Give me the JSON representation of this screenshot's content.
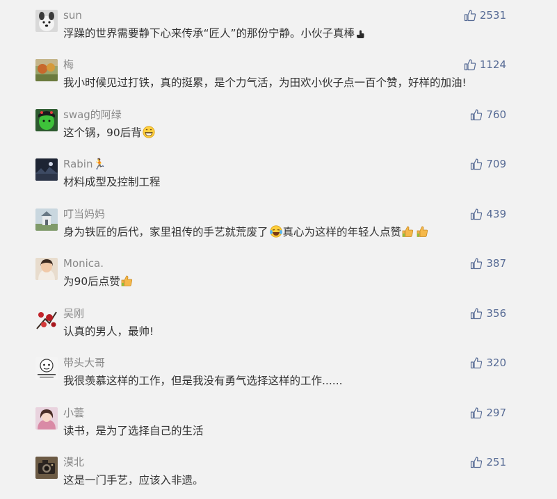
{
  "comments": [
    {
      "nickname": "sun",
      "content": "浮躁的世界需要静下心来传承“匠人”的那份宁静。小伙子真棒",
      "emoji": "pointing-hand-emoji",
      "likes": "2531",
      "avatar": "white-dog-avatar"
    },
    {
      "nickname": "梅",
      "content": "我小时候见过打铁，真的挺累，是个力气活，为田欢小伙子点一百个赞，好样的加油!",
      "emoji": "",
      "likes": "1124",
      "avatar": "autumn-landscape-avatar"
    },
    {
      "nickname": "swag的阿绿",
      "content": "这个锅，90后背",
      "emoji": "grinning-face-emoji",
      "likes": "760",
      "avatar": "green-face-avatar"
    },
    {
      "nickname": "Rabin🏃",
      "content": "材料成型及控制工程",
      "emoji": "",
      "likes": "709",
      "avatar": "dark-night-avatar"
    },
    {
      "nickname": "叮当妈妈",
      "content": "身为铁匠的后代，家里祖传的手艺就荒废了",
      "content_after": "真心为这样的年轻人点赞",
      "emoji": "crying-laughing-emoji",
      "emoji_after": "two-thumbs-up-emoji",
      "likes": "439",
      "avatar": "building-photo-avatar"
    },
    {
      "nickname": "Monica.",
      "content": "为90后点赞",
      "emoji": "thumbs-up-emoji",
      "likes": "387",
      "avatar": "girl-photo-avatar"
    },
    {
      "nickname": "吴刚",
      "content": "认真的男人，最帅!",
      "emoji": "",
      "likes": "356",
      "avatar": "red-flowers-avatar"
    },
    {
      "nickname": "带头大哥",
      "content": "我很羡慕这样的工作，但是我没有勇气选择这样的工作......",
      "emoji": "",
      "likes": "320",
      "avatar": "cartoon-meme-avatar"
    },
    {
      "nickname": "小蕓",
      "content": "读书，是为了选择自己的生活",
      "emoji": "",
      "likes": "297",
      "avatar": "girl-portrait-avatar"
    },
    {
      "nickname": "漠北",
      "content": "这是一门手艺，应该入非遗。",
      "emoji": "",
      "likes": "251",
      "avatar": "camera-photo-avatar"
    }
  ],
  "colors": {
    "background": "#f2f2f2",
    "nickname": "#888888",
    "content": "#333333",
    "like": "#576b95"
  }
}
